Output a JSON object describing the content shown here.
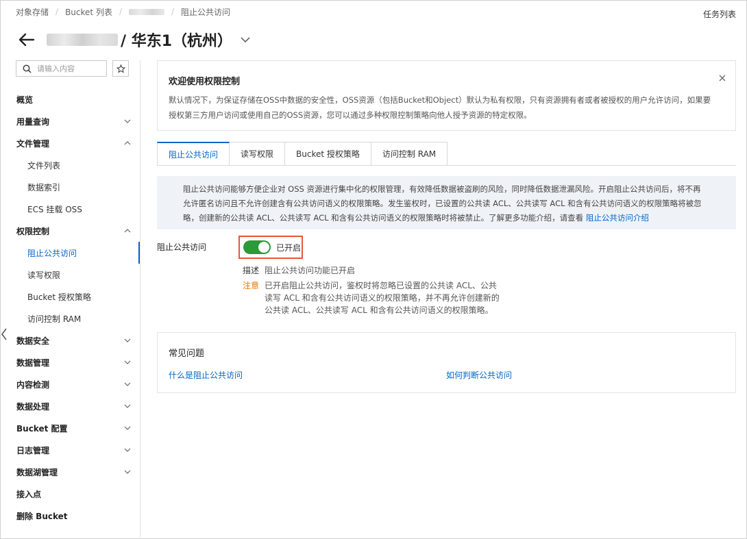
{
  "breadcrumb": {
    "item1": "对象存储",
    "item2": "Bucket 列表",
    "item4": "阻止公共访问"
  },
  "header": {
    "task_list": "任务列表",
    "title": "/ 华东1（杭州）"
  },
  "sidebar": {
    "search_placeholder": "请输入内容",
    "items": [
      {
        "label": "概览",
        "level": "top",
        "chevron": "none"
      },
      {
        "label": "用量查询",
        "level": "top",
        "chevron": "down"
      },
      {
        "label": "文件管理",
        "level": "top",
        "chevron": "up"
      },
      {
        "label": "文件列表",
        "level": "sub",
        "chevron": "none"
      },
      {
        "label": "数据索引",
        "level": "sub",
        "chevron": "none"
      },
      {
        "label": "ECS 挂载 OSS",
        "level": "sub",
        "chevron": "none"
      },
      {
        "label": "权限控制",
        "level": "top",
        "chevron": "up"
      },
      {
        "label": "阻止公共访问",
        "level": "sub",
        "chevron": "none",
        "active": true
      },
      {
        "label": "读写权限",
        "level": "sub",
        "chevron": "none"
      },
      {
        "label": "Bucket 授权策略",
        "level": "sub",
        "chevron": "none"
      },
      {
        "label": "访问控制 RAM",
        "level": "sub",
        "chevron": "none"
      },
      {
        "label": "数据安全",
        "level": "top",
        "chevron": "down"
      },
      {
        "label": "数据管理",
        "level": "top",
        "chevron": "down"
      },
      {
        "label": "内容检测",
        "level": "top",
        "chevron": "down"
      },
      {
        "label": "数据处理",
        "level": "top",
        "chevron": "down"
      },
      {
        "label": "Bucket 配置",
        "level": "top",
        "chevron": "down"
      },
      {
        "label": "日志管理",
        "level": "top",
        "chevron": "down"
      },
      {
        "label": "数据湖管理",
        "level": "top",
        "chevron": "down"
      },
      {
        "label": "接入点",
        "level": "top",
        "chevron": "none"
      },
      {
        "label": "删除 Bucket",
        "level": "top",
        "chevron": "none"
      }
    ]
  },
  "welcome": {
    "title": "欢迎使用权限控制",
    "line1": "默认情况下，为保证存储在OSS中数据的安全性，OSS资源（包括Bucket和Object）默认为私有权限，只有资源拥有者或者被授权的用户允许访问，如果要",
    "line2": "授权第三方用户访问或使用自己的OSS资源，您可以通过多种权限控制策略向他人授予资源的特定权限。"
  },
  "tabs": [
    "阻止公共访问",
    "读写权限",
    "Bucket 授权策略",
    "访问控制 RAM"
  ],
  "notice": {
    "line1": "阻止公共访问能够方便企业对 OSS 资源进行集中化的权限管理，有效降低数据被盗刷的风险，同时降低数据泄漏风险。开启阻止公共访问后，将不再",
    "line2": "允许匿名访问且不允许创建含有公共访问语义的权限策略。发生鉴权时，已设置的公共读 ACL、公共读写 ACL 和含有公共访问语义的权限策略将被忽",
    "line3": "略，创建新的公共读 ACL、公共读写 ACL 和含有公共访问语义的权限策略时将被禁止。了解更多功能介绍，请查看 ",
    "link": "阻止公共访问介绍"
  },
  "setting": {
    "label": "阻止公共访问",
    "switch_on": true,
    "switch_label": "已开启",
    "desc_key": "描述",
    "desc_value": "阻止公共访问功能已开启",
    "warn_key": "注意",
    "warn_line1": "已开启阻止公共访问，鉴权时将忽略已设置的公共读 ACL、公共",
    "warn_line2": "读写 ACL 和含有公共访问语义的权限策略，并不再允许创建新的",
    "warn_line3": "公共读 ACL、公共读写 ACL 和含有公共访问语义的权限策略。"
  },
  "faq": {
    "title": "常见问题",
    "link1": "什么是阻止公共访问",
    "link2": "如何判断公共访问"
  },
  "colors": {
    "accent": "#0064c8",
    "switch_on": "#2a9a3b",
    "highlight_box": "#e8553a",
    "warn": "#e07800"
  }
}
